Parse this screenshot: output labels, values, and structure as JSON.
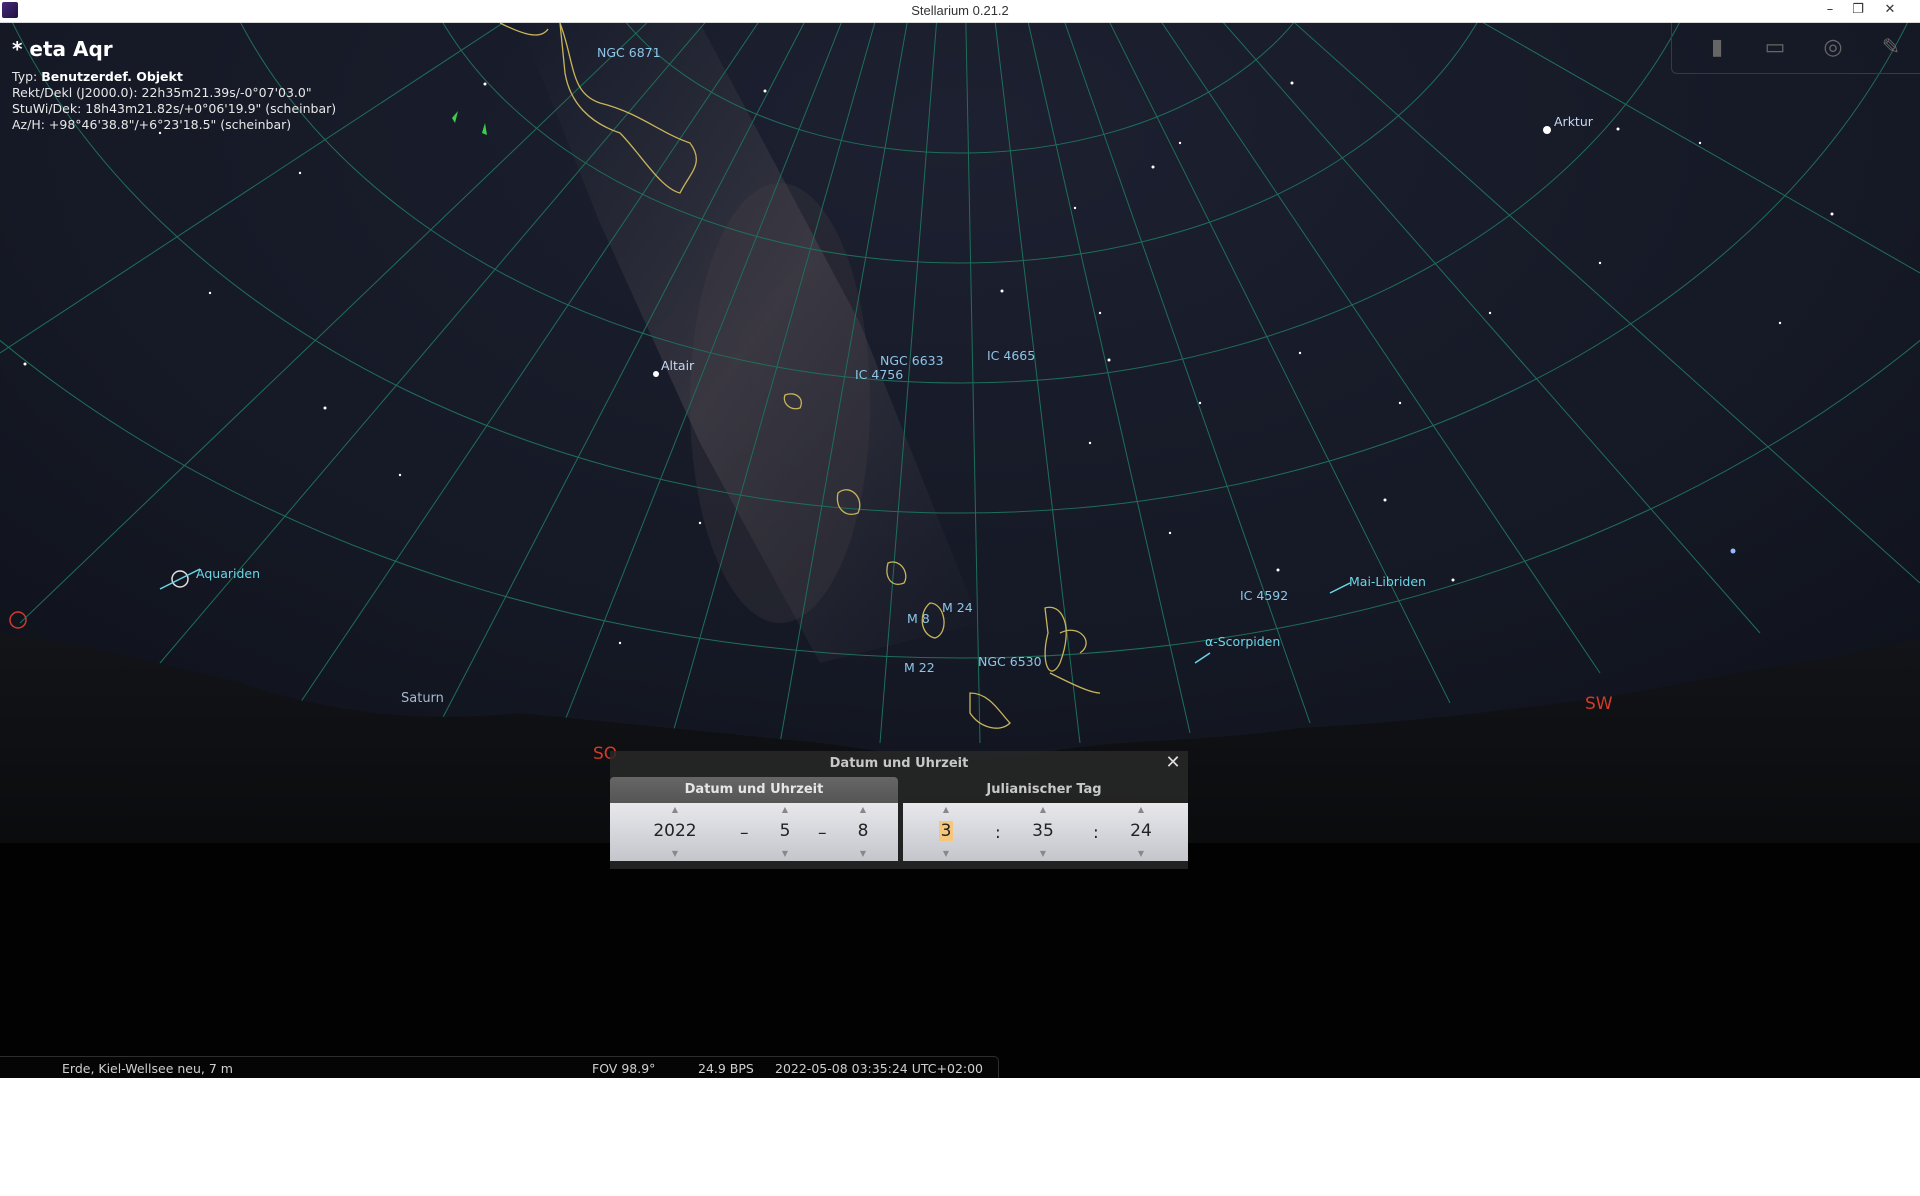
{
  "window": {
    "title": "Stellarium 0.21.2",
    "minimize": "–",
    "restore": "❐",
    "close": "✕"
  },
  "info": {
    "object_name": "* eta Aqr",
    "type_label": "Typ:",
    "type_value": "Benutzerdef. Objekt",
    "radec": "Rekt/Dekl (J2000.0): 22h35m21.39s/-0°07'03.0\"",
    "hadec": "StuWi/Dek: 18h43m21.82s/+0°06'19.9\" (scheinbar)",
    "azalt": "Az/H: +98°46'38.8\"/+6°23'18.5\" (scheinbar)"
  },
  "toolbar": {
    "icons": [
      "bin-icon",
      "screen-icon",
      "target-icon",
      "wrench-icon"
    ]
  },
  "sky_labels": {
    "ngc6871": "NGC 6871",
    "arktur": "Arktur",
    "altair": "Altair",
    "ngc6633": "NGC 6633",
    "ic4665": "IC 4665",
    "ic4756": "IC 4756",
    "aquariden": "Aquariden",
    "m24": "M 24",
    "m8": "M 8",
    "m22": "M 22",
    "ngc6530": "NGC 6530",
    "ic4592": "IC 4592",
    "mai_libriden": "Mai-Libriden",
    "alpha_scorpiden": "α-Scorpiden",
    "saturn": "Saturn",
    "sw": "SW",
    "so": "SO"
  },
  "dialog": {
    "title": "Datum und Uhrzeit",
    "tab_date": "Datum und Uhrzeit",
    "tab_jd": "Julianischer Tag",
    "year": "2022",
    "month": "5",
    "day": "8",
    "hour": "3",
    "minute": "35",
    "second": "24",
    "date_sep": "–",
    "time_sep": ":"
  },
  "status": {
    "location": "Erde, Kiel-Wellsee neu, 7 m",
    "fov": "FOV 98.9°",
    "fps": "24.9 BPS",
    "datetime": "2022-05-08 03:35:24 UTC+02:00"
  },
  "colors": {
    "grid": "#1f6e5a",
    "constellation": "#c8b45a",
    "label": "#8ec5e8",
    "cardinal": "#d33a2a"
  }
}
